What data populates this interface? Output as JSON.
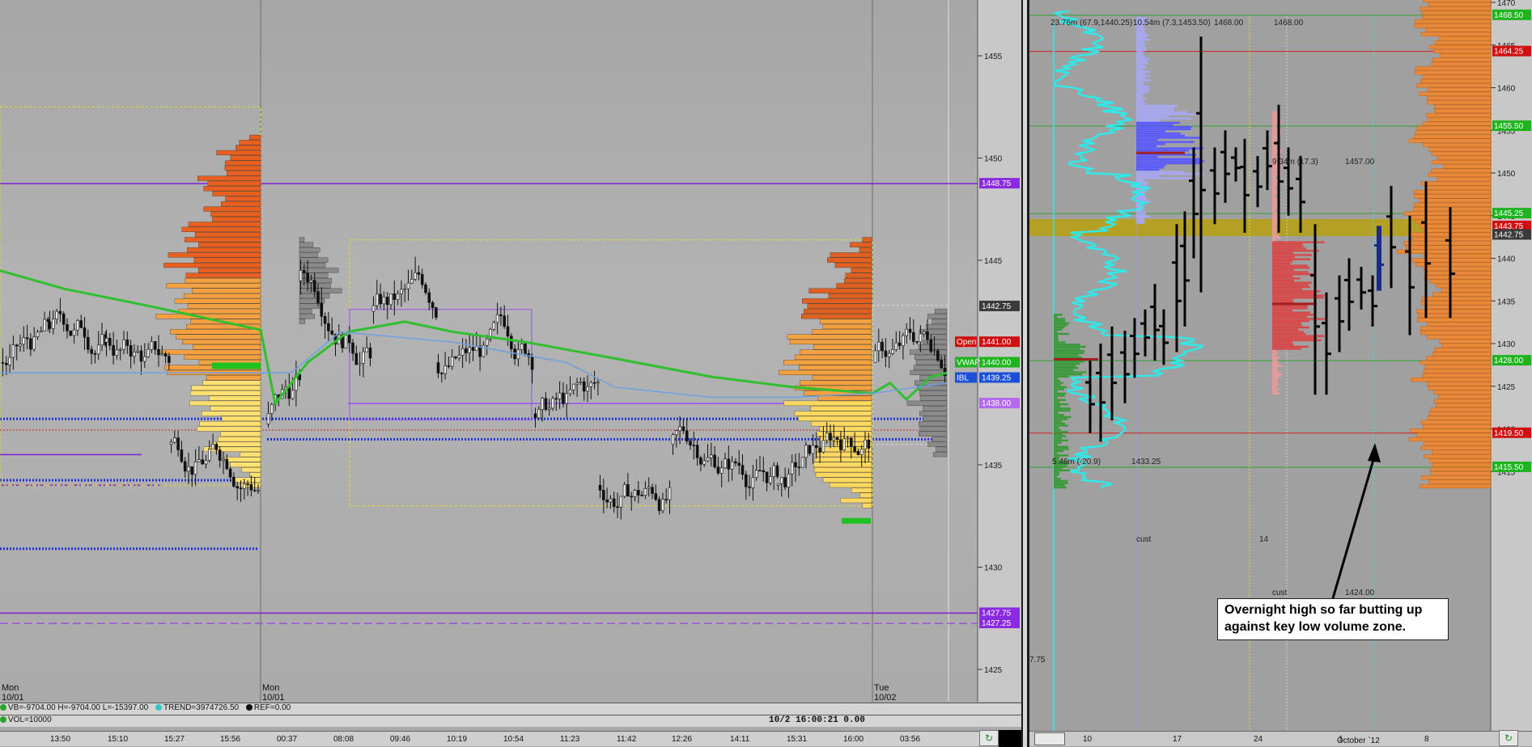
{
  "left_chart": {
    "price_ticks": [
      "1455",
      "1450",
      "1445",
      "1440",
      "1435",
      "1430",
      "1425"
    ],
    "level_tags": [
      {
        "label": "1448.75",
        "color": "#8a2be2",
        "price": 1448.75
      },
      {
        "label": "1442.75",
        "color": "#3a3a3a",
        "price": 1442.75
      },
      {
        "label": "1441.00",
        "color": "#d01010",
        "price": 1441.0
      },
      {
        "label": "1440.00",
        "color": "#1fb41f",
        "price": 1440.0
      },
      {
        "label": "1439.25",
        "color": "#1b4fd8",
        "price": 1439.25
      },
      {
        "label": "1438.00",
        "color": "#b569f0",
        "price": 1438.0
      },
      {
        "label": "1427.75",
        "color": "#8a2be2",
        "price": 1427.75
      },
      {
        "label": "1427.25",
        "color": "#8a2be2",
        "price": 1427.25
      }
    ],
    "ref_labels": [
      {
        "label": "Open",
        "color": "#d01010"
      },
      {
        "label": "VWAP",
        "color": "#1fb41f"
      },
      {
        "label": "IBL",
        "color": "#1b4fd8"
      }
    ],
    "session_labels": [
      {
        "day": "Mon",
        "date": "10/01"
      },
      {
        "day": "Mon",
        "date": "10/01"
      },
      {
        "day": "Tue",
        "date": "10/02"
      }
    ],
    "time_ticks": [
      "13:50",
      "15:10",
      "15:27",
      "15:56",
      "00:37",
      "08:08",
      "09:46",
      "10:19",
      "10:54",
      "11:23",
      "11:42",
      "12:26",
      "14:11",
      "15:31",
      "16:00",
      "03:56"
    ],
    "status": {
      "vb": "VB=-9704.00 H=-9704.00 L=-15397.00",
      "trend": "TREND=3974726.50",
      "ref": "REF=0.00",
      "vol": "VOL=10000",
      "overlay_text": "10/2 16:00:21 0.00"
    }
  },
  "right_chart": {
    "price_ticks": [
      "1470",
      "1465",
      "1460",
      "1455",
      "1450",
      "1445",
      "1440",
      "1435",
      "1430",
      "1425",
      "1420",
      "1415"
    ],
    "level_tags": [
      {
        "label": "1468.50",
        "color": "#1fb41f",
        "price": 1468.5
      },
      {
        "label": "1464.25",
        "color": "#d01010",
        "price": 1464.25
      },
      {
        "label": "1455.50",
        "color": "#1fb41f",
        "price": 1455.5
      },
      {
        "label": "1445.25",
        "color": "#1fb41f",
        "price": 1445.25
      },
      {
        "label": "1443.75",
        "color": "#d01010",
        "price": 1443.75
      },
      {
        "label": "1442.75",
        "color": "#3a3a3a",
        "price": 1442.75
      },
      {
        "label": "1428.00",
        "color": "#1fb41f",
        "price": 1428.0
      },
      {
        "label": "1419.50",
        "color": "#d01010",
        "price": 1419.5
      },
      {
        "label": "1415.50",
        "color": "#1fb41f",
        "price": 1415.5
      }
    ],
    "profile_notes": [
      "23.76m (67.9,1440.25)",
      "10.54m (7.3,1453.50)",
      "1468.00",
      "1468.00",
      "9.34m (17.3)",
      "1457.00",
      "5.46m (-20.9)",
      "1433.25",
      "cust",
      "cust",
      "1424.00",
      "14",
      "7.75"
    ],
    "date_ticks": [
      "10",
      "17",
      "24",
      "1",
      "October `12",
      "8"
    ],
    "callout": {
      "line1": "Overnight high so far butting up",
      "line2": "against key low volume zone."
    }
  }
}
